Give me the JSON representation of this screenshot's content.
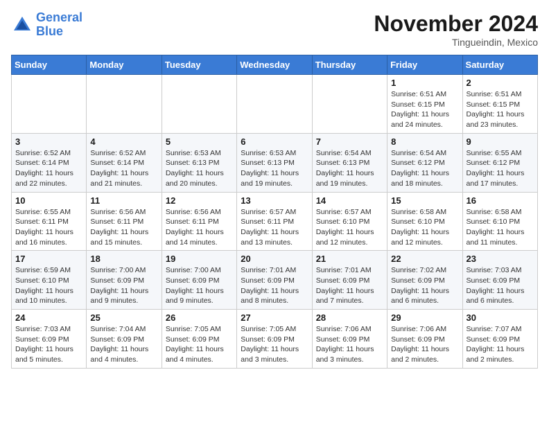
{
  "header": {
    "logo_line1": "General",
    "logo_line2": "Blue",
    "month": "November 2024",
    "location": "Tingueindin, Mexico"
  },
  "weekdays": [
    "Sunday",
    "Monday",
    "Tuesday",
    "Wednesday",
    "Thursday",
    "Friday",
    "Saturday"
  ],
  "weeks": [
    [
      {
        "day": "",
        "info": ""
      },
      {
        "day": "",
        "info": ""
      },
      {
        "day": "",
        "info": ""
      },
      {
        "day": "",
        "info": ""
      },
      {
        "day": "",
        "info": ""
      },
      {
        "day": "1",
        "info": "Sunrise: 6:51 AM\nSunset: 6:15 PM\nDaylight: 11 hours\nand 24 minutes."
      },
      {
        "day": "2",
        "info": "Sunrise: 6:51 AM\nSunset: 6:15 PM\nDaylight: 11 hours\nand 23 minutes."
      }
    ],
    [
      {
        "day": "3",
        "info": "Sunrise: 6:52 AM\nSunset: 6:14 PM\nDaylight: 11 hours\nand 22 minutes."
      },
      {
        "day": "4",
        "info": "Sunrise: 6:52 AM\nSunset: 6:14 PM\nDaylight: 11 hours\nand 21 minutes."
      },
      {
        "day": "5",
        "info": "Sunrise: 6:53 AM\nSunset: 6:13 PM\nDaylight: 11 hours\nand 20 minutes."
      },
      {
        "day": "6",
        "info": "Sunrise: 6:53 AM\nSunset: 6:13 PM\nDaylight: 11 hours\nand 19 minutes."
      },
      {
        "day": "7",
        "info": "Sunrise: 6:54 AM\nSunset: 6:13 PM\nDaylight: 11 hours\nand 19 minutes."
      },
      {
        "day": "8",
        "info": "Sunrise: 6:54 AM\nSunset: 6:12 PM\nDaylight: 11 hours\nand 18 minutes."
      },
      {
        "day": "9",
        "info": "Sunrise: 6:55 AM\nSunset: 6:12 PM\nDaylight: 11 hours\nand 17 minutes."
      }
    ],
    [
      {
        "day": "10",
        "info": "Sunrise: 6:55 AM\nSunset: 6:11 PM\nDaylight: 11 hours\nand 16 minutes."
      },
      {
        "day": "11",
        "info": "Sunrise: 6:56 AM\nSunset: 6:11 PM\nDaylight: 11 hours\nand 15 minutes."
      },
      {
        "day": "12",
        "info": "Sunrise: 6:56 AM\nSunset: 6:11 PM\nDaylight: 11 hours\nand 14 minutes."
      },
      {
        "day": "13",
        "info": "Sunrise: 6:57 AM\nSunset: 6:11 PM\nDaylight: 11 hours\nand 13 minutes."
      },
      {
        "day": "14",
        "info": "Sunrise: 6:57 AM\nSunset: 6:10 PM\nDaylight: 11 hours\nand 12 minutes."
      },
      {
        "day": "15",
        "info": "Sunrise: 6:58 AM\nSunset: 6:10 PM\nDaylight: 11 hours\nand 12 minutes."
      },
      {
        "day": "16",
        "info": "Sunrise: 6:58 AM\nSunset: 6:10 PM\nDaylight: 11 hours\nand 11 minutes."
      }
    ],
    [
      {
        "day": "17",
        "info": "Sunrise: 6:59 AM\nSunset: 6:10 PM\nDaylight: 11 hours\nand 10 minutes."
      },
      {
        "day": "18",
        "info": "Sunrise: 7:00 AM\nSunset: 6:09 PM\nDaylight: 11 hours\nand 9 minutes."
      },
      {
        "day": "19",
        "info": "Sunrise: 7:00 AM\nSunset: 6:09 PM\nDaylight: 11 hours\nand 9 minutes."
      },
      {
        "day": "20",
        "info": "Sunrise: 7:01 AM\nSunset: 6:09 PM\nDaylight: 11 hours\nand 8 minutes."
      },
      {
        "day": "21",
        "info": "Sunrise: 7:01 AM\nSunset: 6:09 PM\nDaylight: 11 hours\nand 7 minutes."
      },
      {
        "day": "22",
        "info": "Sunrise: 7:02 AM\nSunset: 6:09 PM\nDaylight: 11 hours\nand 6 minutes."
      },
      {
        "day": "23",
        "info": "Sunrise: 7:03 AM\nSunset: 6:09 PM\nDaylight: 11 hours\nand 6 minutes."
      }
    ],
    [
      {
        "day": "24",
        "info": "Sunrise: 7:03 AM\nSunset: 6:09 PM\nDaylight: 11 hours\nand 5 minutes."
      },
      {
        "day": "25",
        "info": "Sunrise: 7:04 AM\nSunset: 6:09 PM\nDaylight: 11 hours\nand 4 minutes."
      },
      {
        "day": "26",
        "info": "Sunrise: 7:05 AM\nSunset: 6:09 PM\nDaylight: 11 hours\nand 4 minutes."
      },
      {
        "day": "27",
        "info": "Sunrise: 7:05 AM\nSunset: 6:09 PM\nDaylight: 11 hours\nand 3 minutes."
      },
      {
        "day": "28",
        "info": "Sunrise: 7:06 AM\nSunset: 6:09 PM\nDaylight: 11 hours\nand 3 minutes."
      },
      {
        "day": "29",
        "info": "Sunrise: 7:06 AM\nSunset: 6:09 PM\nDaylight: 11 hours\nand 2 minutes."
      },
      {
        "day": "30",
        "info": "Sunrise: 7:07 AM\nSunset: 6:09 PM\nDaylight: 11 hours\nand 2 minutes."
      }
    ]
  ]
}
